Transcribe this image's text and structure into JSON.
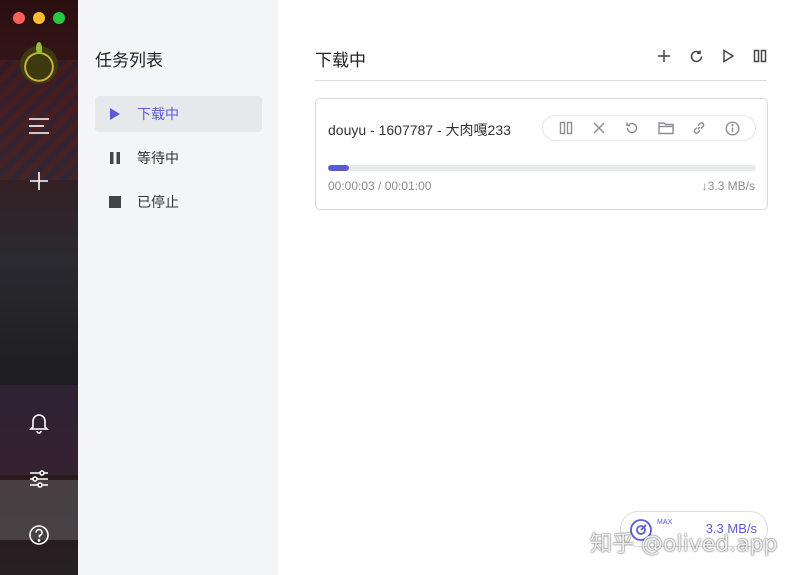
{
  "sidebar": {
    "title": "任务列表",
    "items": [
      {
        "label": "下载中",
        "icon": "play-icon",
        "active": true
      },
      {
        "label": "等待中",
        "icon": "pause-icon",
        "active": false
      },
      {
        "label": "已停止",
        "icon": "stop-icon",
        "active": false
      }
    ]
  },
  "rail": {
    "icons": [
      "app-logo",
      "menu-icon",
      "add-icon",
      "bell-icon",
      "sliders-icon",
      "help-icon"
    ]
  },
  "main": {
    "title": "下载中",
    "toolbar": [
      "add-icon",
      "refresh-icon",
      "resume-all-icon",
      "pause-all-icon"
    ]
  },
  "tasks": [
    {
      "name": "douyu - 1607787 - 大肉嘎233",
      "progress_fraction": 0.05,
      "time": "00:00:03 / 00:01:00",
      "speed": "↓3.3 MB/s",
      "actions": [
        "pause-icon",
        "close-icon",
        "restart-icon",
        "folder-icon",
        "link-icon",
        "info-icon"
      ]
    }
  ],
  "speedometer": {
    "max_label": "MAX",
    "value": "3.3 MB/s"
  },
  "watermark": "知乎 @olived.app",
  "colors": {
    "accent": "#5b5bd6",
    "sidebar_bg": "#f4f5f7"
  }
}
